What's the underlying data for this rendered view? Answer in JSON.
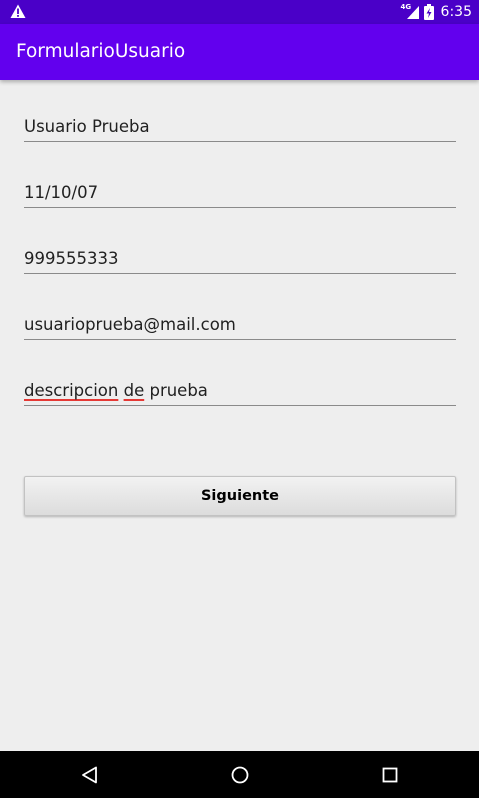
{
  "status_bar": {
    "warning_icon": "warning-icon",
    "network_type": "4G",
    "signal_icon": "signal-icon",
    "battery_icon": "battery-charging-icon",
    "time": "6:35"
  },
  "app_bar": {
    "title": "FormularioUsuario",
    "color": "#6200ee",
    "status_color": "#4a00c8"
  },
  "form": {
    "fields": [
      {
        "value": "Usuario Prueba"
      },
      {
        "value": "11/10/07"
      },
      {
        "value": "999555333"
      },
      {
        "value": "usuarioprueba@mail.com"
      },
      {
        "value": "descripcion de prueba",
        "parts": [
          "descripcion",
          "de",
          "prueba"
        ]
      }
    ],
    "next_button_label": "Siguiente"
  },
  "nav_bar": {
    "back_icon": "back-icon",
    "home_icon": "home-icon",
    "recents_icon": "recents-icon"
  }
}
